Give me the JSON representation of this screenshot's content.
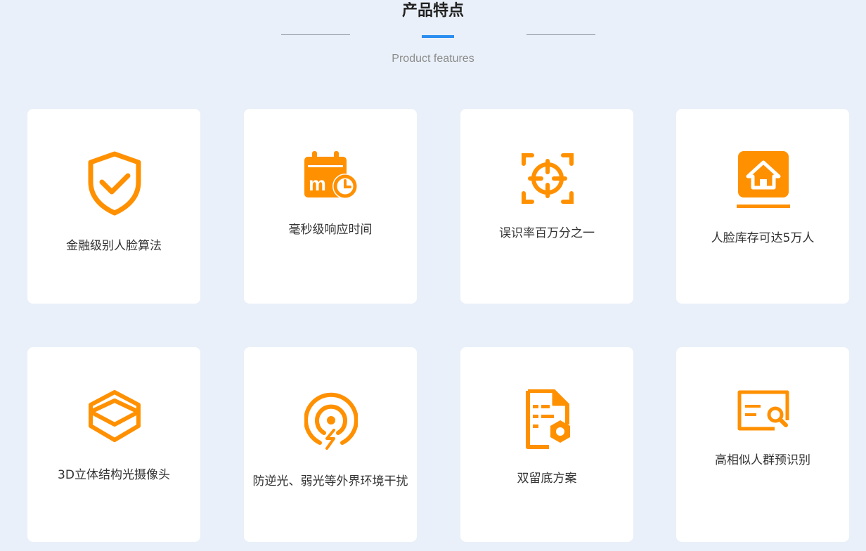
{
  "header": {
    "title": "产品特点",
    "subtitle": "Product features"
  },
  "accent_color": "#ff9000",
  "features": [
    {
      "label": "金融级别人脸算法",
      "icon": "shield-check-icon"
    },
    {
      "label": "毫秒级响应时间",
      "icon": "calendar-clock-icon"
    },
    {
      "label": "误识率百万分之一",
      "icon": "target-scan-icon"
    },
    {
      "label": "人脸库存可达5万人",
      "icon": "house-database-icon"
    },
    {
      "label": "3D立体结构光摄像头",
      "icon": "3d-layers-icon"
    },
    {
      "label": "防逆光、弱光等外界环境干扰",
      "icon": "light-signal-icon"
    },
    {
      "label": "双留底方案",
      "icon": "document-hex-icon"
    },
    {
      "label": "高相似人群预识别",
      "icon": "id-card-search-icon"
    }
  ]
}
